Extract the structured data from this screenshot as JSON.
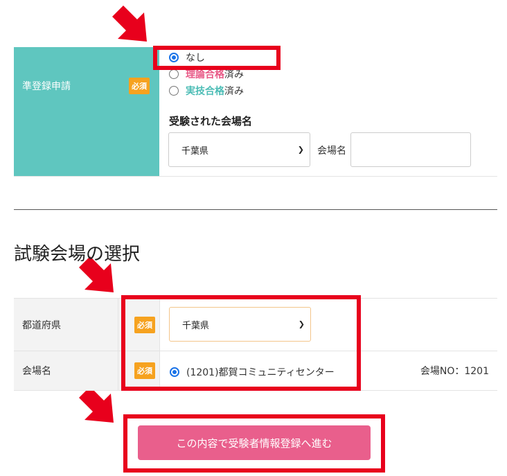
{
  "top_form": {
    "label": "準登録申請",
    "required_badge": "必須",
    "options": [
      {
        "text": "なし",
        "checked": true
      },
      {
        "prefix": "理論合格",
        "suffix": "済み",
        "checked": false
      },
      {
        "prefix": "実技合格",
        "suffix": "済み",
        "checked": false
      }
    ],
    "venue_heading": "受験された会場名",
    "prefecture_select": "千葉県",
    "venue_label": "会場名",
    "venue_input_value": ""
  },
  "section": {
    "title": "試験会場の選択"
  },
  "venue_table": {
    "prefecture_label": "都道府県",
    "prefecture_badge": "必須",
    "prefecture_select": "千葉県",
    "venue_label": "会場名",
    "venue_badge": "必須",
    "venue_option": "(1201)都賀コミュニティセンター",
    "venue_no": "会場NO：1201"
  },
  "submit": {
    "label": "この内容で受験者情報登録へ進む"
  },
  "colors": {
    "teal": "#5fc6bf",
    "badge": "#f6a21f",
    "submit": "#e95f8c",
    "highlight": "#e8001c"
  }
}
